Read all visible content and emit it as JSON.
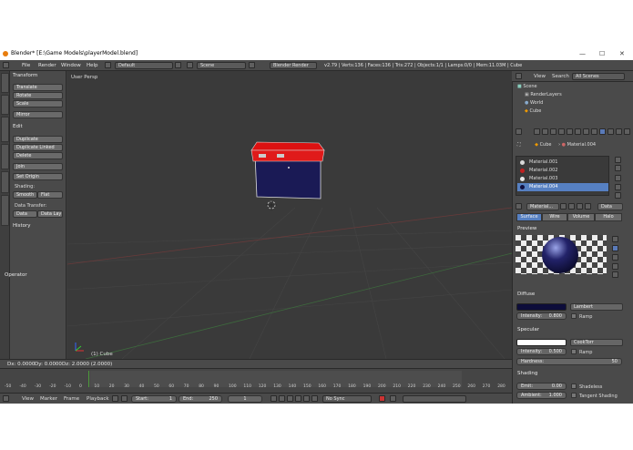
{
  "window": {
    "title": "Blender* [E:\\Game Models\\playerModel.blend]"
  },
  "menubar": {
    "items": [
      "File",
      "Render",
      "Window",
      "Help"
    ],
    "layout": "Default",
    "scene": "Scene",
    "engine": "Blender Render",
    "stats": "v2.79 | Verts:136 | Faces:136 | Tris:272 | Objects:1/1 | Lamps:0/0 | Mem:11.03M | Cube"
  },
  "toolshelf": {
    "tabs": [
      "Tools",
      "Create",
      "Relations",
      "Animation",
      "Physics",
      "Grease Pencil"
    ],
    "transform_header": "Transform",
    "transform": [
      "Translate",
      "Rotate",
      "Scale",
      "Mirror"
    ],
    "edit_header": "Edit",
    "edit": [
      "Duplicate",
      "Duplicate Linked",
      "Delete",
      "Join"
    ],
    "set_origin": "Set Origin",
    "shading_label": "Shading:",
    "smooth": "Smooth",
    "flat": "Flat",
    "data_transfer_label": "Data Transfer:",
    "data": "Data",
    "data_lay": "Data Lay",
    "history_header": "History",
    "operator_header": "Operator"
  },
  "viewport": {
    "view_name": "User Persp",
    "object_label": "(1) Cube"
  },
  "status": {
    "dx": "Dx: 0.0000",
    "dy": "Dy: 0.0000",
    "dz": "Dz: 2.0000 (2.0000)"
  },
  "timeline": {
    "ticks": [
      "-50",
      "-40",
      "-30",
      "-20",
      "-10",
      "0",
      "10",
      "20",
      "30",
      "40",
      "50",
      "60",
      "70",
      "80",
      "90",
      "100",
      "110",
      "120",
      "130",
      "140",
      "150",
      "160",
      "170",
      "180",
      "190",
      "200",
      "210",
      "220",
      "230",
      "240",
      "250",
      "260",
      "270",
      "280"
    ],
    "menu": [
      "View",
      "Marker",
      "Frame",
      "Playback"
    ],
    "start_label": "Start:",
    "start": "1",
    "end_label": "End:",
    "end": "250",
    "current": "1",
    "sync": "No Sync"
  },
  "outliner": {
    "menu": [
      "View",
      "Search"
    ],
    "filter": "All Scenes",
    "rows": [
      "Scene",
      "RenderLayers",
      "World",
      "Cube"
    ]
  },
  "properties": {
    "breadcrumb_object": "Cube",
    "breadcrumb_material": "Material.004",
    "slots": [
      {
        "name": "Material.001",
        "color": "#d8d8d8"
      },
      {
        "name": "Material.002",
        "color": "#c02020"
      },
      {
        "name": "Material.003",
        "color": "#e8e8e8"
      },
      {
        "name": "Material.004",
        "color": "#101040"
      }
    ],
    "selected_slot": 3,
    "material_field": "Material...",
    "data_dropdown": "Data",
    "tabs": [
      "Surface",
      "Wire",
      "Volume",
      "Halo"
    ],
    "preview_header": "Preview",
    "diffuse_header": "Diffuse",
    "diffuse_color": "#0d0d3a",
    "diffuse_shader": "Lambert",
    "intensity_label": "Intensity:",
    "diffuse_intensity": "0.800",
    "ramp": "Ramp",
    "specular_header": "Specular",
    "specular_shader": "CookTorr",
    "specular_intensity": "0.500",
    "hardness_label": "Hardness:",
    "hardness": "50",
    "shading_header": "Shading",
    "emit_label": "Emit:",
    "emit": "0.00",
    "shadeless": "Shadeless",
    "ambient_label": "Ambient:",
    "ambient": "1.000",
    "tangent_shading": "Tangent Shading"
  }
}
